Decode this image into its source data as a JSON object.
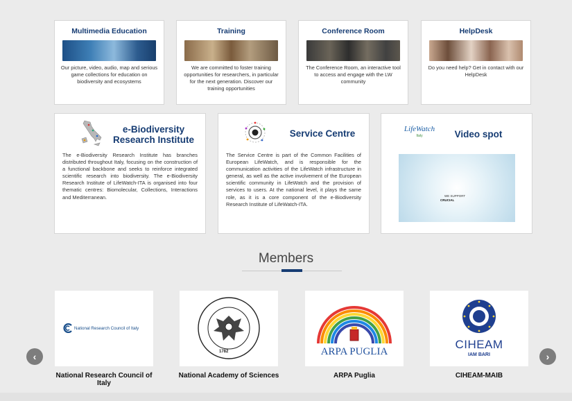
{
  "top_cards": [
    {
      "title": "Multimedia Education",
      "desc": "Our picture, video, audio, map and serious game collections for education on biodiversity and ecosystems"
    },
    {
      "title": "Training",
      "desc": "We are committed to foster training opportunities for researchers, in particular for the next generation. Discover our training opportunities"
    },
    {
      "title": "Conference Room",
      "desc": "The Conference Room, an interactive tool to access and engage with the LW community"
    },
    {
      "title": "HelpDesk",
      "desc": "Do you need help? Get in contact with our HelpDesk"
    }
  ],
  "feature_cards": {
    "ebio": {
      "title": "e-Biodiversity Research Institute",
      "text": "The e-Biodiversity Research Institute has branches distributed throughout Italy, focusing on the construction of a functional backbone and seeks to reinforce integrated scientific research into biodiversity. The e-Biodiversity Research Institute of LifeWatch-ITA is organised into four thematic centres: Biomolecular, Collections, Interactions and Mediterranean."
    },
    "service": {
      "title": "Service Centre",
      "text": "The Service Centre is part of the Common Facilities of European LifeWatch, and is responsible for the communication activities of the LifeWatch infrastructure in general, as well as the active involvement of the European scientific community in LifeWatch and the provision of services to users. At the national level, it plays the same role, as it is a core component of the e-Biodiversity Research Institute of LifeWatch-ITA."
    },
    "video": {
      "title": "Video spot",
      "logo_text": "LifeWatch",
      "logo_sub": "Italy",
      "video_line1": "WE SUPPORT",
      "video_line2": "CRUCIAL"
    }
  },
  "members": {
    "title": "Members",
    "items": [
      {
        "name": "National Research Council of Italy",
        "logo_text": "National Research Council of Italy"
      },
      {
        "name": "National Academy of Sciences",
        "logo_text": "ACCADEMIA NAZIONALE DELLE SCIENZE DETTA DEI XL",
        "logo_year": "1782"
      },
      {
        "name": "ARPA Puglia",
        "logo_text": "ARPA PUGLIA"
      },
      {
        "name": "CIHEAM-MAIB",
        "logo_text": "CIHEAM",
        "logo_sub": "IAM BARI"
      }
    ],
    "prev_icon": "chevron-left-icon",
    "next_icon": "chevron-right-icon"
  },
  "colors": {
    "title_blue": "#163c73",
    "background": "#ebebeb"
  }
}
